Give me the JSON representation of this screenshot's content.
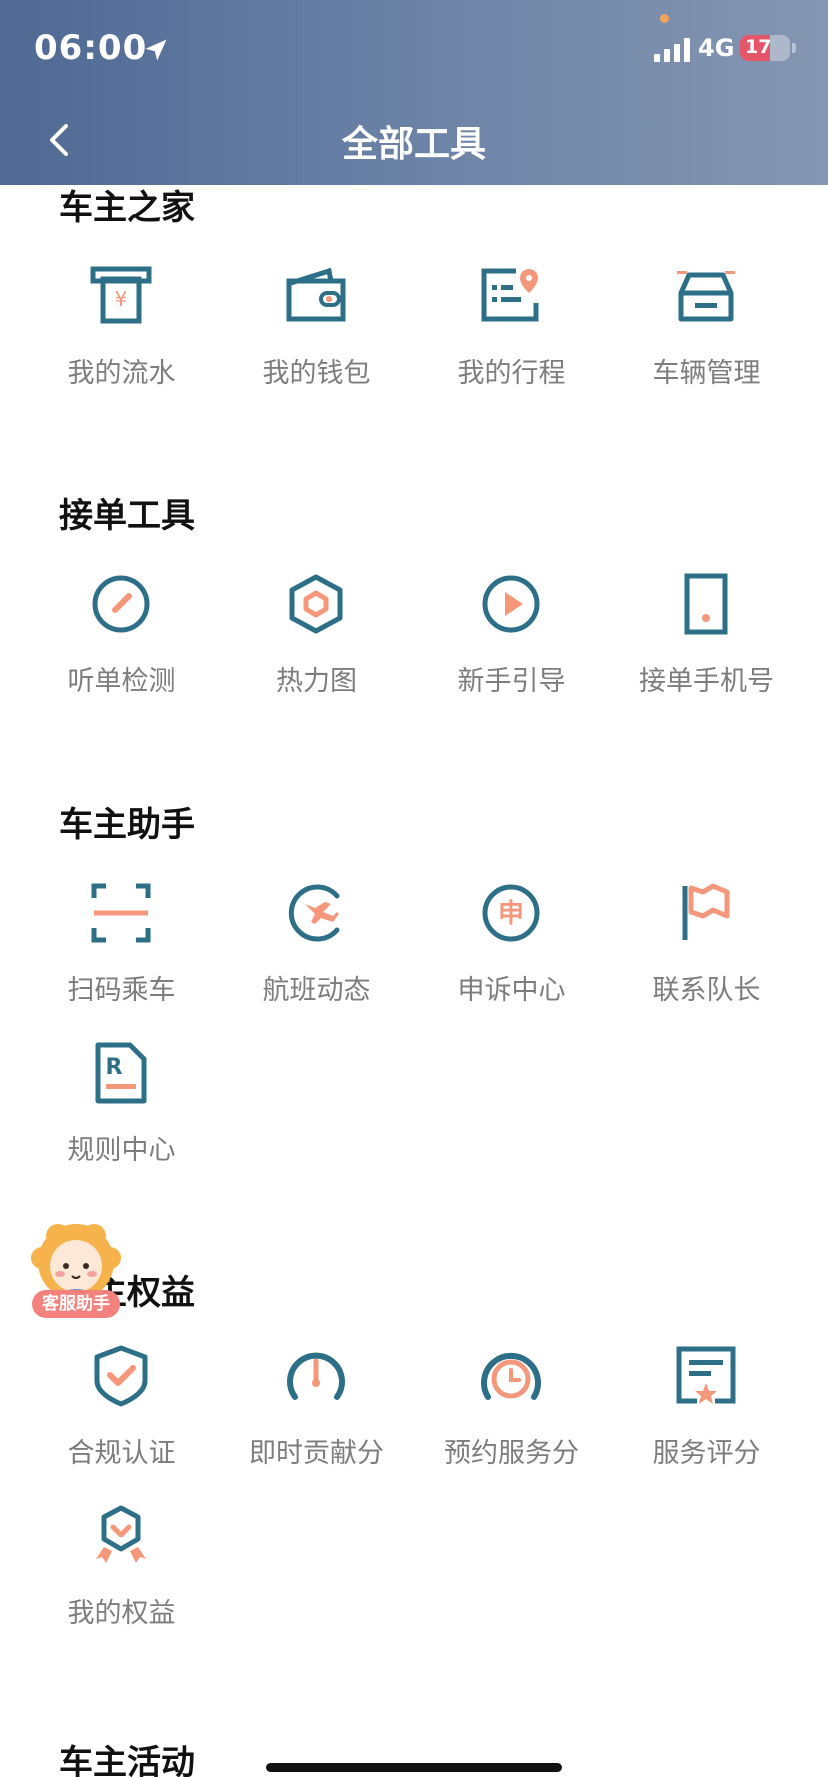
{
  "status_bar": {
    "time": "06:00",
    "network": "4G",
    "battery": "17",
    "battery_level": 0.17
  },
  "nav": {
    "title": "全部工具",
    "back_icon": "chevron-left-icon"
  },
  "sections": [
    {
      "title": "车主之家",
      "items": [
        {
          "label": "我的流水",
          "icon": "atm-receipt-icon"
        },
        {
          "label": "我的钱包",
          "icon": "wallet-icon"
        },
        {
          "label": "我的行程",
          "icon": "trip-list-icon"
        },
        {
          "label": "车辆管理",
          "icon": "car-icon"
        }
      ]
    },
    {
      "title": "接单工具",
      "items": [
        {
          "label": "听单检测",
          "icon": "gauge-icon"
        },
        {
          "label": "热力图",
          "icon": "hexagon-icon"
        },
        {
          "label": "新手引导",
          "icon": "play-circle-icon"
        },
        {
          "label": "接单手机号",
          "icon": "phone-icon"
        }
      ]
    },
    {
      "title": "车主助手",
      "items": [
        {
          "label": "扫码乘车",
          "icon": "scan-icon"
        },
        {
          "label": "航班动态",
          "icon": "flight-icon"
        },
        {
          "label": "申诉中心",
          "icon": "appeal-icon"
        },
        {
          "label": "联系队长",
          "icon": "flag-icon"
        },
        {
          "label": "规则中心",
          "icon": "rule-doc-icon"
        }
      ]
    },
    {
      "title": "车主权益",
      "items": [
        {
          "label": "合规认证",
          "icon": "shield-check-icon"
        },
        {
          "label": "即时贡献分",
          "icon": "score-gauge-icon"
        },
        {
          "label": "预约服务分",
          "icon": "clock-gauge-icon"
        },
        {
          "label": "服务评分",
          "icon": "rating-board-icon"
        },
        {
          "label": "我的权益",
          "icon": "medal-icon"
        }
      ]
    },
    {
      "title": "车主活动",
      "items": []
    }
  ],
  "mascot": {
    "badge": "客服助手",
    "icon": "assistant-mascot-icon"
  },
  "colors": {
    "header_start": "#4f6994",
    "header_end": "#8596b1",
    "icon_primary": "#2e6f88",
    "icon_accent": "#f4977a",
    "label": "#7d7d7d"
  }
}
